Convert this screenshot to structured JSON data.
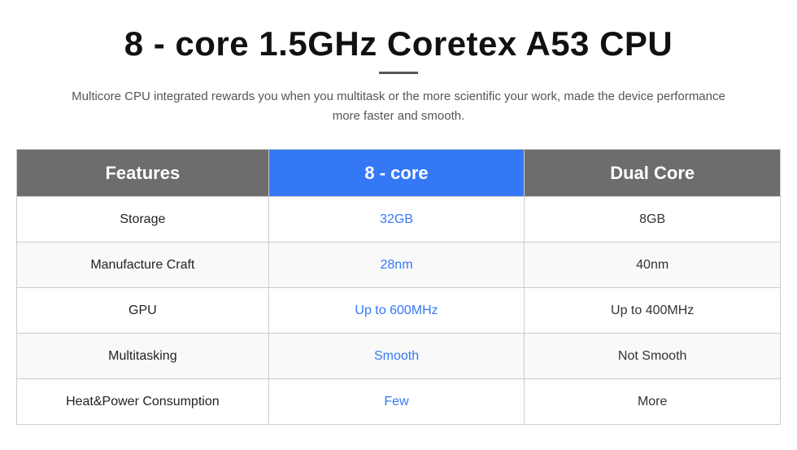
{
  "title": "8 - core 1.5GHz Coretex A53 CPU",
  "subtitle": "Multicore CPU integrated rewards you when you multitask or the more scientific your work, made the device performance more faster and smooth.",
  "table": {
    "headers": {
      "features": "Features",
      "col1": "8 - core",
      "col2": "Dual Core"
    },
    "rows": [
      {
        "feature": "Storage",
        "col1": "32GB",
        "col2": "8GB"
      },
      {
        "feature": "Manufacture Craft",
        "col1": "28nm",
        "col2": "40nm"
      },
      {
        "feature": "GPU",
        "col1": "Up to 600MHz",
        "col2": "Up to 400MHz"
      },
      {
        "feature": "Multitasking",
        "col1": "Smooth",
        "col2": "Not Smooth"
      },
      {
        "feature": "Heat&Power Consumption",
        "col1": "Few",
        "col2": "More"
      }
    ]
  }
}
